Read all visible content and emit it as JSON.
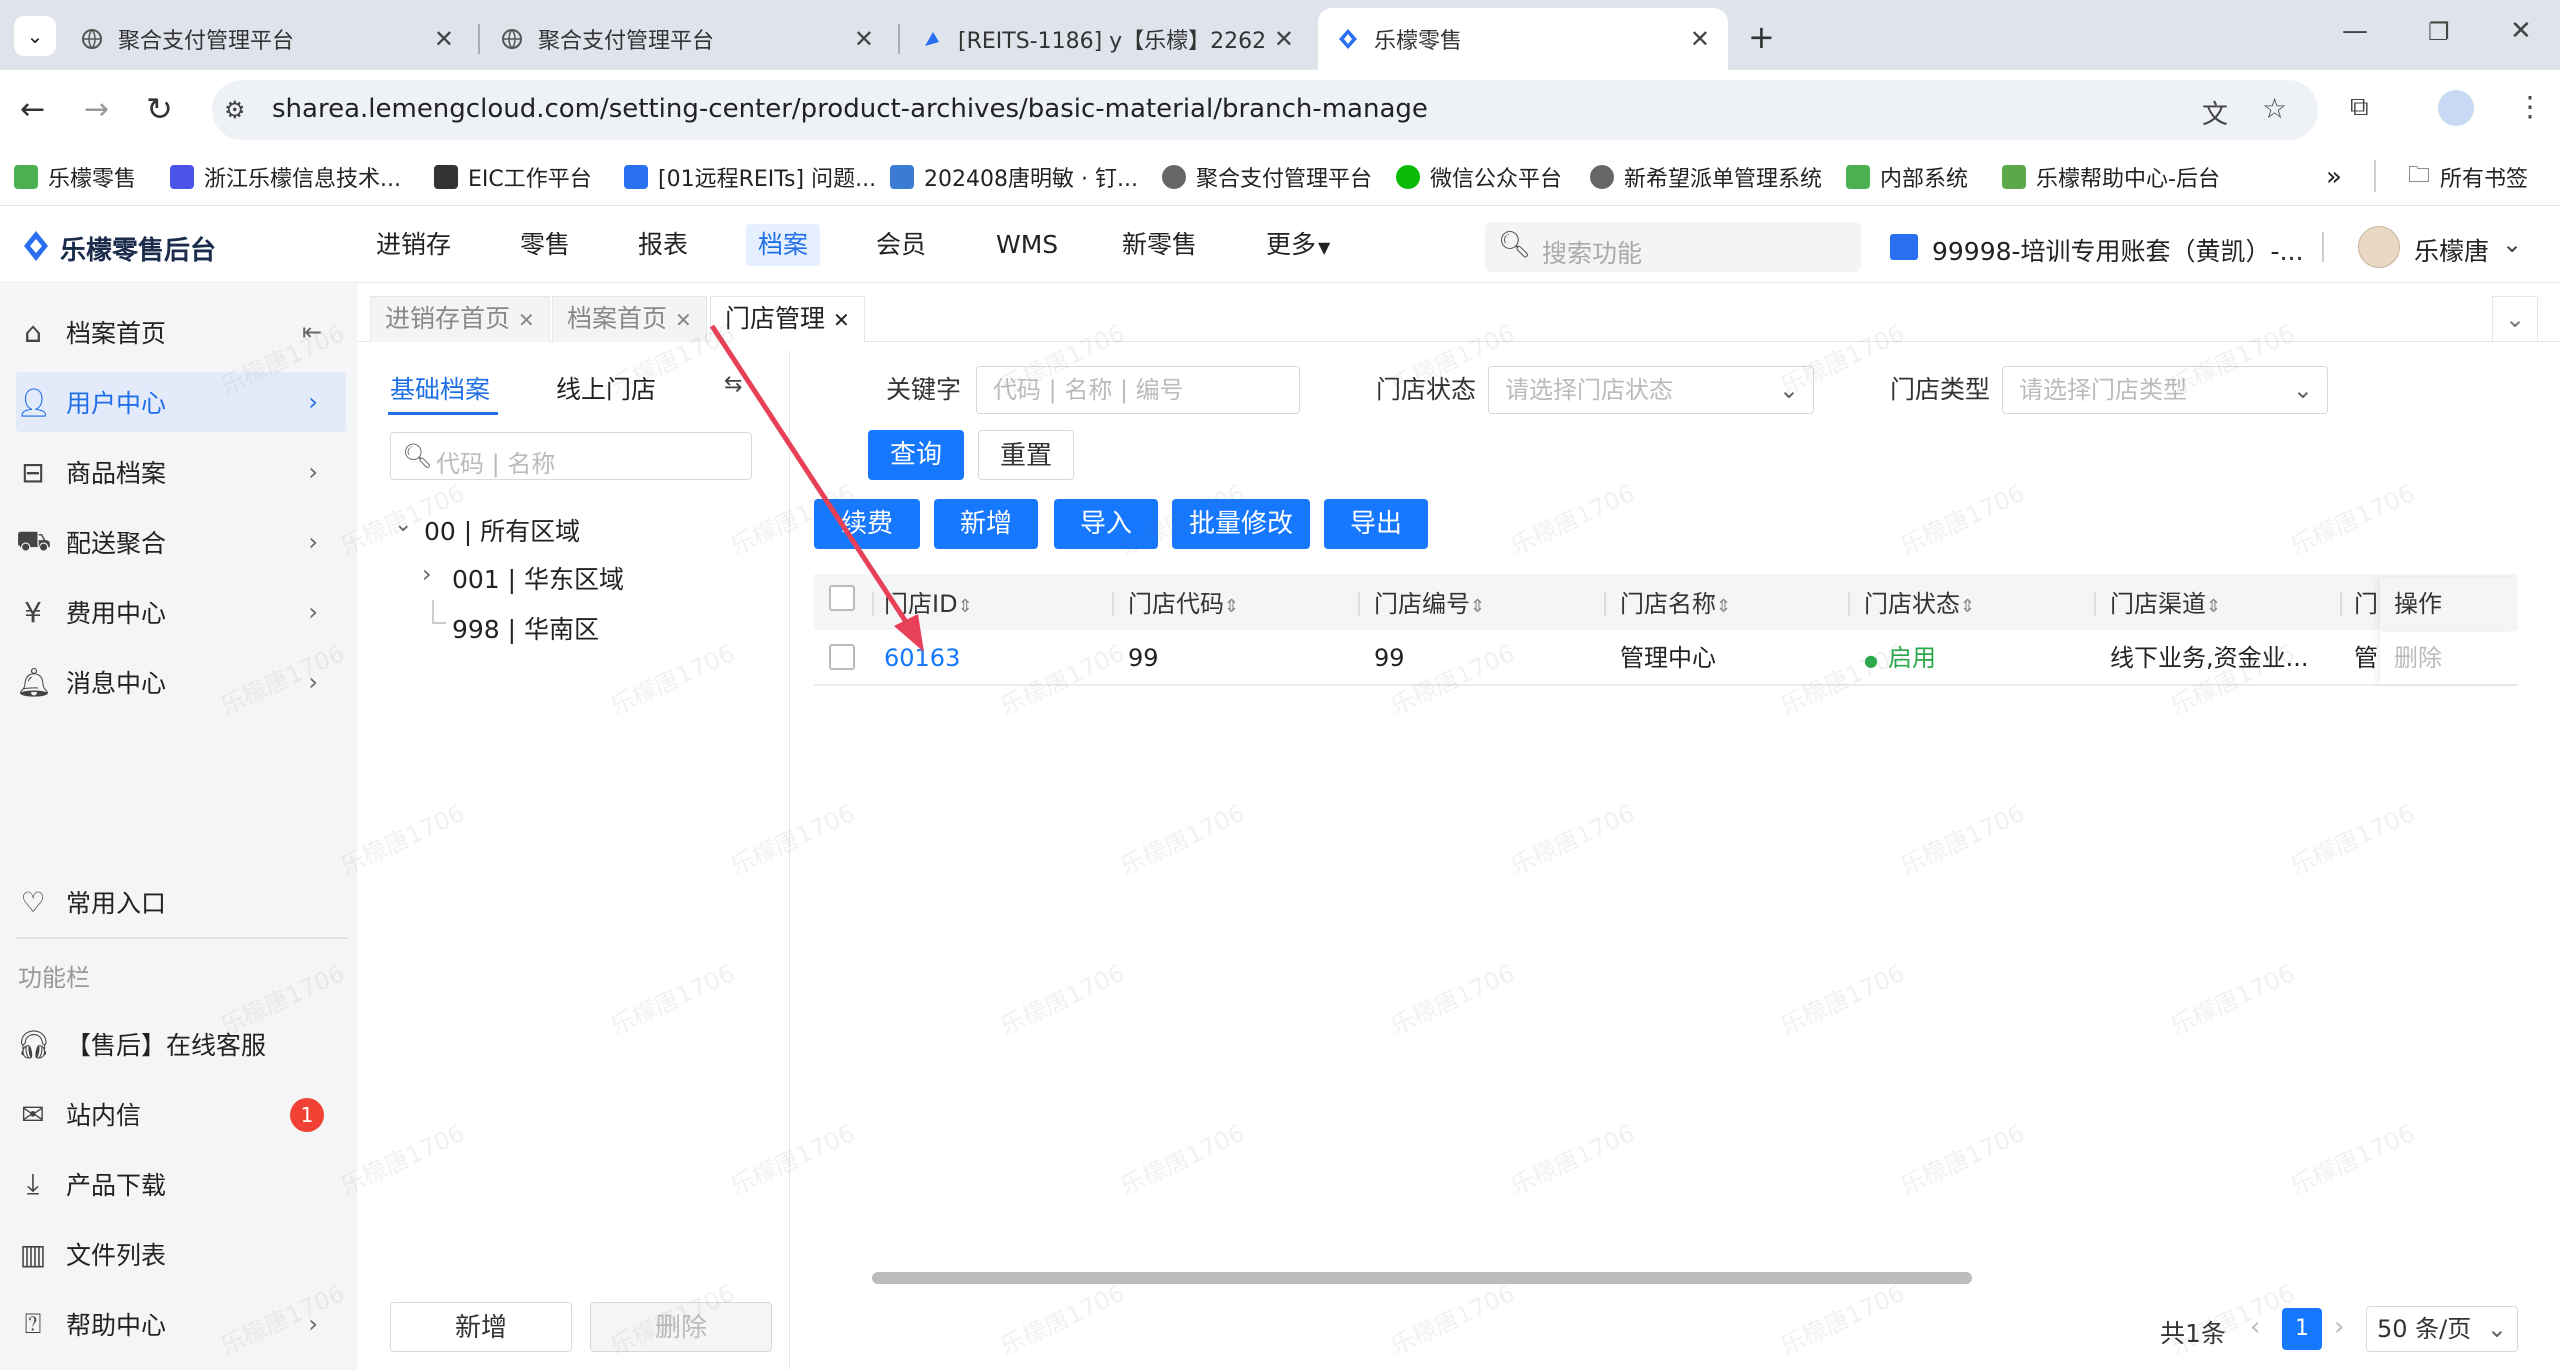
{
  "browser": {
    "tabs": [
      {
        "title": "聚合支付管理平台",
        "active": false
      },
      {
        "title": "聚合支付管理平台",
        "active": false
      },
      {
        "title": "[REITS-1186] y【乐檬】2262",
        "active": false
      },
      {
        "title": "乐檬零售",
        "active": true
      }
    ],
    "url": "sharea.lemengcloud.com/setting-center/product-archives/basic-material/branch-manage",
    "bookmarks": [
      "乐檬零售",
      "浙江乐檬信息技术...",
      "EIC工作平台",
      "[01远程REITs] 问题...",
      "202408唐明敏 · 钉...",
      "聚合支付管理平台",
      "微信公众平台",
      "新希望派单管理系统",
      "内部系统",
      "乐檬帮助中心-后台"
    ],
    "all_bookmarks": "所有书签",
    "overflow": "»"
  },
  "app": {
    "logo_text": "乐檬零售后台",
    "nav": [
      "进销存",
      "零售",
      "报表",
      "档案",
      "会员",
      "WMS",
      "新零售",
      "更多"
    ],
    "active_nav": "档案",
    "search_placeholder": "搜索功能",
    "account": "99998-培训专用账套（黄凯）-...",
    "user": "乐檬唐"
  },
  "sidebar": {
    "items": [
      {
        "label": "档案首页",
        "icon": "home-icon"
      },
      {
        "label": "用户中心",
        "icon": "user-icon",
        "active": true
      },
      {
        "label": "商品档案",
        "icon": "box-icon"
      },
      {
        "label": "配送聚合",
        "icon": "truck-icon"
      },
      {
        "label": "费用中心",
        "icon": "yen-icon"
      },
      {
        "label": "消息中心",
        "icon": "bell-icon"
      }
    ],
    "common": "常用入口",
    "section": "功能栏",
    "tools": [
      {
        "label": "【售后】在线客服",
        "icon": "headset-icon"
      },
      {
        "label": "站内信",
        "icon": "mail-icon",
        "badge": "1"
      },
      {
        "label": "产品下载",
        "icon": "download-icon"
      },
      {
        "label": "文件列表",
        "icon": "chart-icon"
      },
      {
        "label": "帮助中心",
        "icon": "help-icon"
      }
    ]
  },
  "page_tabs": [
    {
      "label": "进销存首页",
      "active": false
    },
    {
      "label": "档案首页",
      "active": false
    },
    {
      "label": "门店管理",
      "active": true
    }
  ],
  "tree": {
    "tabs": [
      "基础档案",
      "线上门店"
    ],
    "search_placeholder": "代码 | 名称",
    "nodes": [
      "00 | 所有区域",
      "001 | 华东区域",
      "998 | 华南区"
    ],
    "add": "新增",
    "delete": "删除"
  },
  "filters": {
    "keyword_label": "关键字",
    "keyword_placeholder": "代码 | 名称 | 编号",
    "status_label": "门店状态",
    "status_placeholder": "请选择门店状态",
    "type_label": "门店类型",
    "type_placeholder": "请选择门店类型",
    "query": "查询",
    "reset": "重置"
  },
  "actions": [
    "续费",
    "新增",
    "导入",
    "批量修改",
    "导出"
  ],
  "table": {
    "headers": [
      "门店ID",
      "门店代码",
      "门店编号",
      "门店名称",
      "门店状态",
      "门店渠道",
      "门",
      "操作"
    ],
    "rows": [
      {
        "id": "60163",
        "code": "99",
        "number": "99",
        "name": "管理中心",
        "status": "启用",
        "channel": "线下业务,资金业...",
        "extra": "管",
        "op": "删除"
      }
    ]
  },
  "pagination": {
    "total": "共1条",
    "page": "1",
    "size": "50 条/页"
  },
  "watermark": "乐檬唐1706",
  "colors": {
    "primary": "#1677ff",
    "status_green": "#2aa84a",
    "badge_red": "#f04134",
    "annotation": "#e84057"
  }
}
